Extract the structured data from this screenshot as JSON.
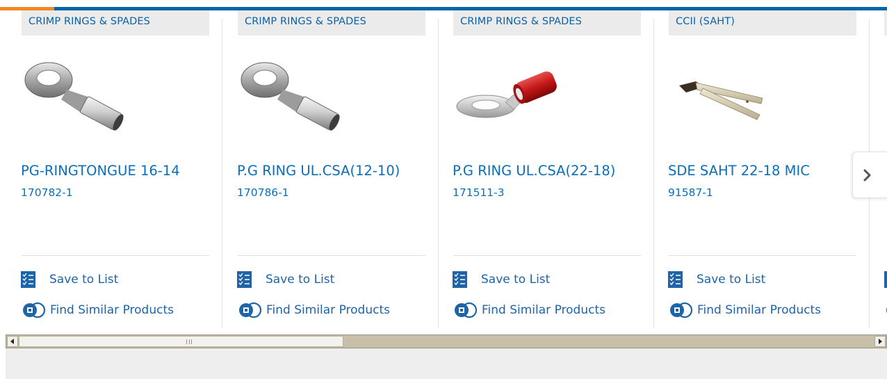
{
  "carousel": {
    "products": [
      {
        "category": "CRIMP RINGS & SPADES",
        "title": "PG-RINGTONGUE 16-14",
        "part_number": "170782-1",
        "image": "ring-terminal-image"
      },
      {
        "category": "CRIMP RINGS & SPADES",
        "title": "P.G RING UL.CSA(12-10)",
        "part_number": "170786-1",
        "image": "ring-terminal-image"
      },
      {
        "category": "CRIMP RINGS & SPADES",
        "title": "P.G RING UL.CSA(22-18)",
        "part_number": "171511-3",
        "image": "insulated-red-ring-terminal-image"
      },
      {
        "category": "CCII (SAHT)",
        "title": "SDE SAHT 22-18 MIC",
        "part_number": "91587-1",
        "image": "crimp-hand-tool-image"
      }
    ],
    "actions": {
      "save_to_list": "Save to List",
      "find_similar": "Find Similar Products"
    },
    "next_icon": "chevron-right-icon"
  },
  "scrollbar": {
    "left_icon": "arrow-left-icon",
    "right_icon": "arrow-right-icon"
  },
  "colors": {
    "accent_blue": "#0066a8",
    "accent_orange": "#f08a24",
    "link_blue": "#0a6fb8",
    "category_bg": "#ebebeb"
  }
}
